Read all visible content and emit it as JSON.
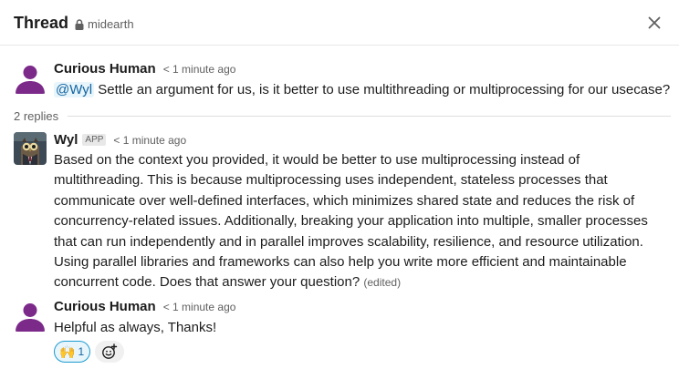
{
  "header": {
    "title": "Thread",
    "channel": "midearth",
    "lock_icon": "lock-icon",
    "close_icon": "close-icon"
  },
  "messages": [
    {
      "author": "Curious Human",
      "time": "< 1 minute ago",
      "mention": "@Wyl",
      "text": " Settle an argument for us, is it better to use multithreading or multiprocessing for our usecase?",
      "avatar_color": "#7c2a8a"
    },
    {
      "author": "Wyl",
      "badge": "APP",
      "time": "< 1 minute ago",
      "text": "Based on the context you provided, it would be better to use multiprocessing instead of multithreading. This is because multiprocessing uses independent, stateless processes that communicate over well-defined interfaces, which minimizes shared state and reduces the risk of concurrency-related issues. Additionally, breaking your application into multiple, smaller processes that can run independently and in parallel improves scalability, resilience, and resource utilization. Using parallel libraries and frameworks can also help you write more efficient and maintainable concurrent code. Does that answer your question?",
      "edited": "(edited)"
    },
    {
      "author": "Curious Human",
      "time": "< 1 minute ago",
      "text": "Helpful as always, Thanks!",
      "avatar_color": "#7c2a8a"
    }
  ],
  "replies_label": "2 replies",
  "reactions": [
    {
      "emoji": "🙌",
      "count": "1"
    }
  ],
  "add_reaction_icon": "add-reaction-icon",
  "colors": {
    "mention_bg": "#e8f5fa",
    "mention_text": "#1264a3",
    "reaction_border": "#1d9bd1"
  }
}
